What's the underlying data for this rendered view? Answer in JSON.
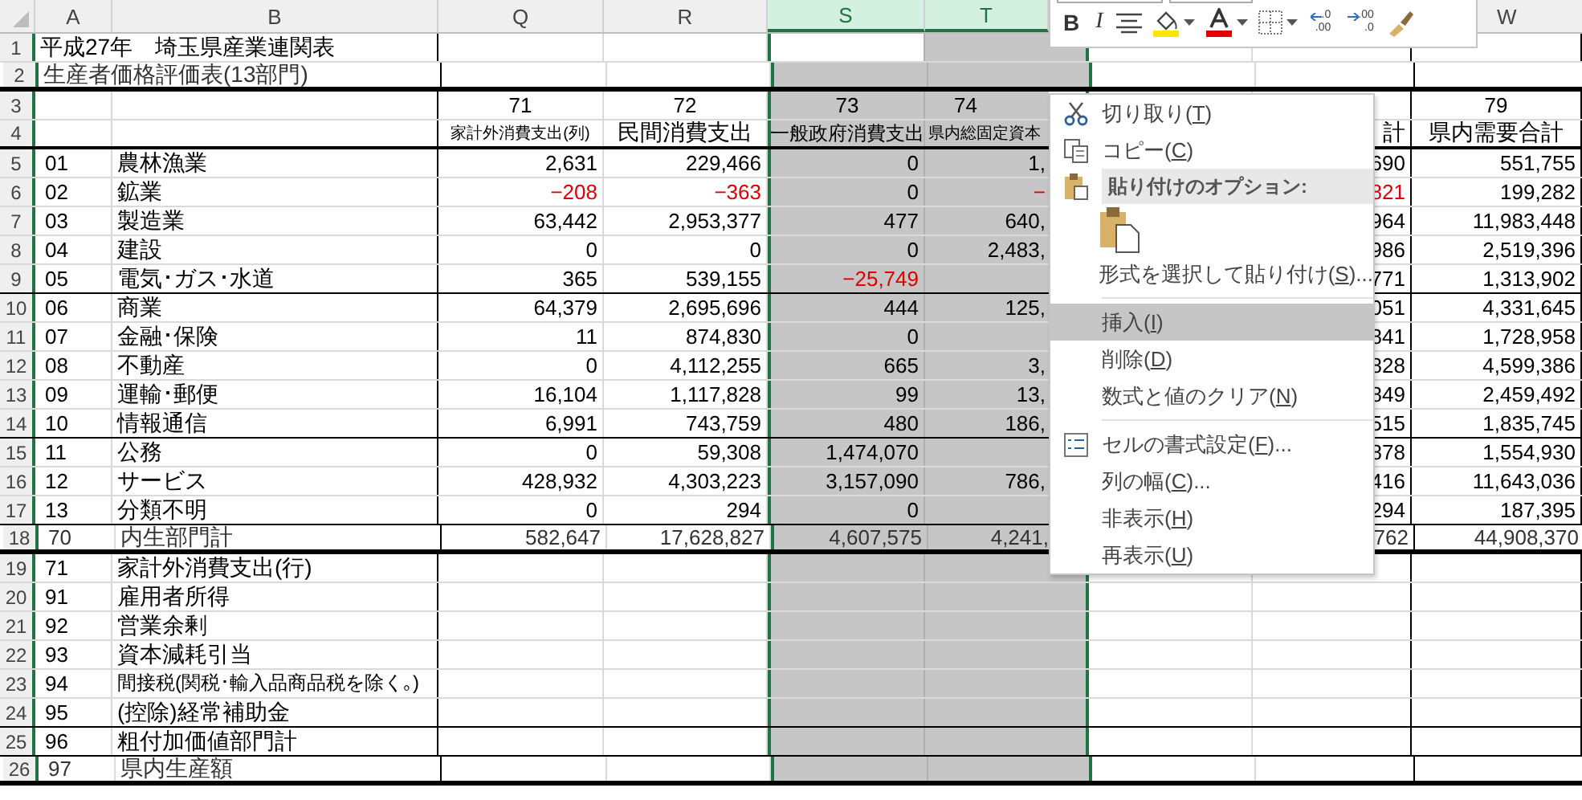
{
  "sheet": {
    "columns": [
      {
        "label": "A",
        "selected": false
      },
      {
        "label": "B",
        "selected": false
      },
      {
        "label": "Q",
        "selected": false
      },
      {
        "label": "R",
        "selected": false
      },
      {
        "label": "S",
        "selected": true
      },
      {
        "label": "T",
        "selected": true
      },
      {
        "label": "W",
        "selected": false
      }
    ],
    "rows": [
      {
        "number": "1",
        "kind": "title",
        "title": "平成27年　埼玉県産業連関表"
      },
      {
        "number": "2",
        "kind": "title",
        "title": "生産者価格評価表(13部門)"
      },
      {
        "number": "3",
        "kind": "head",
        "cells": [
          {
            "text": "71"
          },
          {
            "text": "72"
          },
          {
            "text": "73"
          },
          {
            "text": "74"
          },
          null,
          {
            "text": "79"
          }
        ]
      },
      {
        "number": "4",
        "kind": "label",
        "cells": [
          {
            "text": "家計外消費支出(列)"
          },
          {
            "text": "民間消費支出"
          },
          {
            "text": "一般政府消費支出"
          },
          {
            "text": "県内総固定資本"
          },
          {
            "text": "計"
          },
          {
            "text": "県内需要合計"
          }
        ]
      },
      {
        "number": "5",
        "kind": "data",
        "code": "01",
        "name": "農林漁業",
        "cells": [
          {
            "text": "2,631",
            "negative": false
          },
          {
            "text": "229,466",
            "negative": false
          },
          {
            "text": "0",
            "negative": false
          },
          {
            "text": "1,",
            "negative": false
          },
          {
            "text": "690",
            "negative": false
          },
          {
            "text": "551,755",
            "negative": false
          }
        ]
      },
      {
        "number": "6",
        "kind": "data",
        "code": "02",
        "name": "鉱業",
        "cells": [
          {
            "text": "−208",
            "negative": true
          },
          {
            "text": "−363",
            "negative": true
          },
          {
            "text": "0",
            "negative": false
          },
          {
            "text": "−",
            "negative": true
          },
          {
            "text": "821",
            "negative": true
          },
          {
            "text": "199,282",
            "negative": false
          }
        ]
      },
      {
        "number": "7",
        "kind": "data",
        "code": "03",
        "name": "製造業",
        "cells": [
          {
            "text": "63,442",
            "negative": false
          },
          {
            "text": "2,953,377",
            "negative": false
          },
          {
            "text": "477",
            "negative": false
          },
          {
            "text": "640,",
            "negative": false
          },
          {
            "text": "964",
            "negative": false
          },
          {
            "text": "11,983,448",
            "negative": false
          }
        ]
      },
      {
        "number": "8",
        "kind": "data",
        "code": "04",
        "name": "建設",
        "cells": [
          {
            "text": "0",
            "negative": false
          },
          {
            "text": "0",
            "negative": false
          },
          {
            "text": "0",
            "negative": false
          },
          {
            "text": "2,483,",
            "negative": false
          },
          {
            "text": "986",
            "negative": false
          },
          {
            "text": "2,519,396",
            "negative": false
          }
        ]
      },
      {
        "number": "9",
        "kind": "data",
        "code": "05",
        "name": "電気･ガス･水道",
        "cells": [
          {
            "text": "365",
            "negative": false
          },
          {
            "text": "539,155",
            "negative": false
          },
          {
            "text": "−25,749",
            "negative": true
          },
          null,
          {
            "text": "771",
            "negative": false
          },
          {
            "text": "1,313,902",
            "negative": false
          }
        ]
      },
      {
        "number": "10",
        "kind": "data",
        "code": "06",
        "name": "商業",
        "cells": [
          {
            "text": "64,379",
            "negative": false
          },
          {
            "text": "2,695,696",
            "negative": false
          },
          {
            "text": "444",
            "negative": false
          },
          {
            "text": "125,",
            "negative": false
          },
          {
            "text": "051",
            "negative": false
          },
          {
            "text": "4,331,645",
            "negative": false
          }
        ]
      },
      {
        "number": "11",
        "kind": "data",
        "code": "07",
        "name": "金融･保険",
        "cells": [
          {
            "text": "11",
            "negative": false
          },
          {
            "text": "874,830",
            "negative": false
          },
          {
            "text": "0",
            "negative": false
          },
          null,
          {
            "text": "841",
            "negative": false
          },
          {
            "text": "1,728,958",
            "negative": false
          }
        ]
      },
      {
        "number": "12",
        "kind": "data",
        "code": "08",
        "name": "不動産",
        "cells": [
          {
            "text": "0",
            "negative": false
          },
          {
            "text": "4,112,255",
            "negative": false
          },
          {
            "text": "665",
            "negative": false
          },
          {
            "text": "3,",
            "negative": false
          },
          {
            "text": "828",
            "negative": false
          },
          {
            "text": "4,599,386",
            "negative": false
          }
        ]
      },
      {
        "number": "13",
        "kind": "data",
        "code": "09",
        "name": "運輸･郵便",
        "cells": [
          {
            "text": "16,104",
            "negative": false
          },
          {
            "text": "1,117,828",
            "negative": false
          },
          {
            "text": "99",
            "negative": false
          },
          {
            "text": "13,",
            "negative": false
          },
          {
            "text": "849",
            "negative": false
          },
          {
            "text": "2,459,492",
            "negative": false
          }
        ]
      },
      {
        "number": "14",
        "kind": "data",
        "code": "10",
        "name": "情報通信",
        "cells": [
          {
            "text": "6,991",
            "negative": false
          },
          {
            "text": "743,759",
            "negative": false
          },
          {
            "text": "480",
            "negative": false
          },
          {
            "text": "186,",
            "negative": false
          },
          {
            "text": "515",
            "negative": false
          },
          {
            "text": "1,835,745",
            "negative": false
          }
        ]
      },
      {
        "number": "15",
        "kind": "data",
        "code": "11",
        "name": "公務",
        "cells": [
          {
            "text": "0",
            "negative": false
          },
          {
            "text": "59,308",
            "negative": false
          },
          {
            "text": "1,474,070",
            "negative": false
          },
          null,
          {
            "text": "878",
            "negative": false
          },
          {
            "text": "1,554,930",
            "negative": false
          }
        ]
      },
      {
        "number": "16",
        "kind": "data",
        "code": "12",
        "name": "サービス",
        "cells": [
          {
            "text": "428,932",
            "negative": false
          },
          {
            "text": "4,303,223",
            "negative": false
          },
          {
            "text": "3,157,090",
            "negative": false
          },
          {
            "text": "786,",
            "negative": false
          },
          {
            "text": "416",
            "negative": false
          },
          {
            "text": "11,643,036",
            "negative": false
          }
        ]
      },
      {
        "number": "17",
        "kind": "data",
        "code": "13",
        "name": "分類不明",
        "cells": [
          {
            "text": "0",
            "negative": false
          },
          {
            "text": "294",
            "negative": false
          },
          {
            "text": "0",
            "negative": false
          },
          null,
          {
            "text": "294",
            "negative": false
          },
          {
            "text": "187,395",
            "negative": false
          }
        ]
      },
      {
        "number": "18",
        "kind": "data",
        "code": "70",
        "name": "内生部門計",
        "cells": [
          {
            "text": "582,647",
            "negative": false
          },
          {
            "text": "17,628,827",
            "negative": false
          },
          {
            "text": "4,607,575",
            "negative": false
          },
          {
            "text": "4,241,",
            "negative": false
          },
          {
            "text": "762",
            "negative": false
          },
          {
            "text": "44,908,370",
            "negative": false
          }
        ]
      },
      {
        "number": "19",
        "kind": "data",
        "code": "71",
        "name": "家計外消費支出(行)"
      },
      {
        "number": "20",
        "kind": "data",
        "code": "91",
        "name": "雇用者所得"
      },
      {
        "number": "21",
        "kind": "data",
        "code": "92",
        "name": "営業余剰"
      },
      {
        "number": "22",
        "kind": "data",
        "code": "93",
        "name": "資本減耗引当"
      },
      {
        "number": "23",
        "kind": "data",
        "code": "94",
        "name": "間接税(関税･輸入品商品税を除く｡)"
      },
      {
        "number": "24",
        "kind": "data",
        "code": "95",
        "name": "(控除)経常補助金"
      },
      {
        "number": "25",
        "kind": "data",
        "code": "96",
        "name": "粗付加価値部門計"
      },
      {
        "number": "26",
        "kind": "data",
        "code": "97",
        "name": "県内生産額"
      }
    ]
  },
  "mini_toolbar": {
    "buttons": [
      {
        "kind": "bold",
        "text": "B"
      },
      {
        "kind": "italic",
        "text": "I"
      },
      {
        "kind": "align"
      },
      {
        "kind": "fill"
      },
      {
        "kind": "font-color"
      },
      {
        "kind": "borders"
      },
      {
        "kind": "increase-decimal",
        "top": ".0",
        "bottom": ".00"
      },
      {
        "kind": "decrease-decimal",
        "top": ".00",
        "bottom": ".0"
      },
      {
        "kind": "painter"
      }
    ]
  },
  "context_menu": {
    "items": [
      {
        "kind": "command",
        "before": "切り取り(",
        "accel": "T",
        "after": ")",
        "selected": false
      },
      {
        "kind": "command",
        "before": "コピー(",
        "accel": "C",
        "after": ")",
        "selected": false
      },
      {
        "kind": "header",
        "text": "貼り付けのオプション:"
      },
      {
        "kind": "paste-option"
      },
      {
        "kind": "command",
        "before": "形式を選択して貼り付け(",
        "accel": "S",
        "after": ")...",
        "selected": false
      },
      {
        "kind": "separator"
      },
      {
        "kind": "command",
        "before": "挿入(",
        "accel": "I",
        "after": ")",
        "selected": true
      },
      {
        "kind": "command",
        "before": "削除(",
        "accel": "D",
        "after": ")",
        "selected": false
      },
      {
        "kind": "command",
        "before": "数式と値のクリア(",
        "accel": "N",
        "after": ")",
        "selected": false
      },
      {
        "kind": "separator"
      },
      {
        "kind": "command",
        "before": "セルの書式設定(",
        "accel": "F",
        "after": ")...",
        "selected": false
      },
      {
        "kind": "command",
        "before": "列の幅(",
        "accel": "C",
        "after": ")...",
        "selected": false
      },
      {
        "kind": "command",
        "before": "非表示(",
        "accel": "H",
        "after": ")",
        "selected": false
      },
      {
        "kind": "command",
        "before": "再表示(",
        "accel": "U",
        "after": ")",
        "selected": false
      }
    ]
  }
}
